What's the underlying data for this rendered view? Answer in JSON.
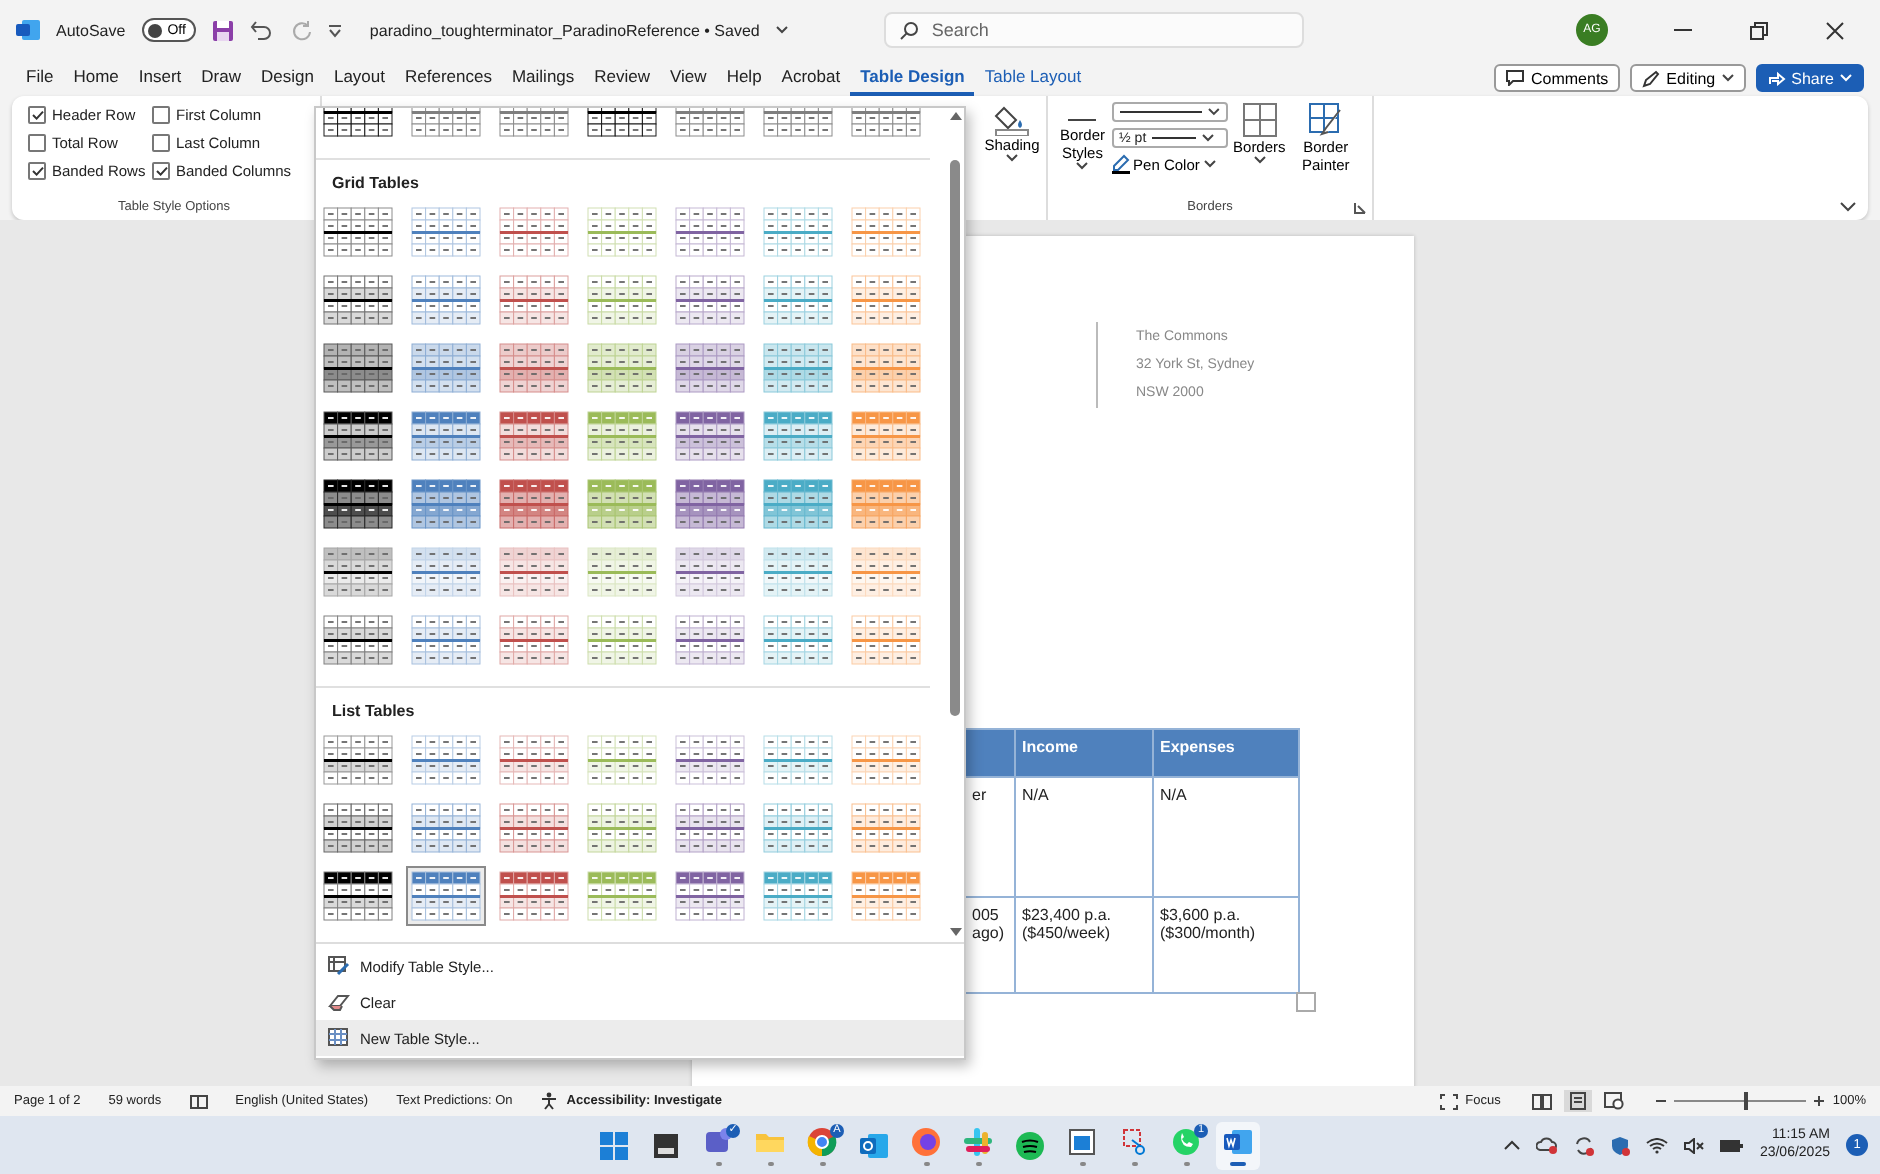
{
  "title_bar": {
    "autosave_label": "AutoSave",
    "autosave": {
      "label": "Off",
      "on": false
    },
    "document_title": "paradino_toughterminator_ParadinoReference • Saved",
    "search": {
      "placeholder": "Search"
    },
    "avatar": "AG"
  },
  "menu_tabs": [
    {
      "label": "File",
      "selected": false,
      "kind": "normal"
    },
    {
      "label": "Home",
      "selected": false,
      "kind": "normal"
    },
    {
      "label": "Insert",
      "selected": false,
      "kind": "normal"
    },
    {
      "label": "Draw",
      "selected": false,
      "kind": "normal"
    },
    {
      "label": "Design",
      "selected": false,
      "kind": "normal"
    },
    {
      "label": "Layout",
      "selected": false,
      "kind": "normal"
    },
    {
      "label": "References",
      "selected": false,
      "kind": "normal"
    },
    {
      "label": "Mailings",
      "selected": false,
      "kind": "normal"
    },
    {
      "label": "Review",
      "selected": false,
      "kind": "normal"
    },
    {
      "label": "View",
      "selected": false,
      "kind": "normal"
    },
    {
      "label": "Help",
      "selected": false,
      "kind": "normal"
    },
    {
      "label": "Acrobat",
      "selected": false,
      "kind": "normal"
    },
    {
      "label": "Table Design",
      "selected": true,
      "kind": "contextual"
    },
    {
      "label": "Table Layout",
      "selected": false,
      "kind": "contextual"
    }
  ],
  "actions": [
    {
      "label": "Comments",
      "kind": "comments"
    },
    {
      "label": "Editing",
      "kind": "editing"
    },
    {
      "label": "Share",
      "kind": "share"
    }
  ],
  "ribbon": {
    "style_options": {
      "title": "Table Style Options",
      "options": [
        {
          "label": "Header Row",
          "checked": true
        },
        {
          "label": "First Column",
          "checked": false
        },
        {
          "label": "Total Row",
          "checked": false
        },
        {
          "label": "Last Column",
          "checked": false
        },
        {
          "label": "Banded Rows",
          "checked": true
        },
        {
          "label": "Banded Columns",
          "checked": true
        }
      ]
    },
    "borders": {
      "title": "Borders",
      "shading": "Shading",
      "border_styles": "Border Styles",
      "pen_weight": "½ pt",
      "pen_color": "Pen Color",
      "borders": "Borders",
      "border_painter": "Border Painter"
    }
  },
  "style_gallery": {
    "sections": [
      {
        "rows": [
          {
            "kind": "plain",
            "styles": [
              {
                "color": "#000000",
                "selected": false
              },
              {
                "color": "#7f7f7f",
                "selected": false
              },
              {
                "color": "#7f7f7f",
                "selected": false
              },
              {
                "color": "#000000",
                "selected": false
              },
              {
                "color": "#7f7f7f",
                "selected": false
              },
              {
                "color": "#7f7f7f",
                "selected": false
              },
              {
                "color": "#7f7f7f",
                "selected": false
              }
            ]
          }
        ]
      },
      {
        "title": "Grid Tables",
        "rows": [
          {
            "kind": "grid-light",
            "styles": [
              {
                "color": "#000000",
                "selected": false
              },
              {
                "color": "#4f81bd",
                "selected": false
              },
              {
                "color": "#c0504d",
                "selected": false
              },
              {
                "color": "#9bbb59",
                "selected": false
              },
              {
                "color": "#8064a2",
                "selected": false
              },
              {
                "color": "#4bacc6",
                "selected": false
              },
              {
                "color": "#f79646",
                "selected": false
              }
            ]
          },
          {
            "kind": "grid",
            "styles": [
              {
                "color": "#000000",
                "selected": false
              },
              {
                "color": "#4f81bd",
                "selected": false
              },
              {
                "color": "#c0504d",
                "selected": false
              },
              {
                "color": "#9bbb59",
                "selected": false
              },
              {
                "color": "#8064a2",
                "selected": false
              },
              {
                "color": "#4bacc6",
                "selected": false
              },
              {
                "color": "#f79646",
                "selected": false
              }
            ]
          },
          {
            "kind": "grid-medium",
            "styles": [
              {
                "color": "#000000",
                "selected": false
              },
              {
                "color": "#4f81bd",
                "selected": false
              },
              {
                "color": "#c0504d",
                "selected": false
              },
              {
                "color": "#9bbb59",
                "selected": false
              },
              {
                "color": "#8064a2",
                "selected": false
              },
              {
                "color": "#4bacc6",
                "selected": false
              },
              {
                "color": "#f79646",
                "selected": false
              }
            ]
          },
          {
            "kind": "grid-header",
            "styles": [
              {
                "color": "#000000",
                "selected": false
              },
              {
                "color": "#4f81bd",
                "selected": false
              },
              {
                "color": "#c0504d",
                "selected": false
              },
              {
                "color": "#9bbb59",
                "selected": false
              },
              {
                "color": "#8064a2",
                "selected": false
              },
              {
                "color": "#4bacc6",
                "selected": false
              },
              {
                "color": "#f79646",
                "selected": false
              }
            ]
          },
          {
            "kind": "grid-dark",
            "styles": [
              {
                "color": "#000000",
                "selected": false
              },
              {
                "color": "#4f81bd",
                "selected": false
              },
              {
                "color": "#c0504d",
                "selected": false
              },
              {
                "color": "#9bbb59",
                "selected": false
              },
              {
                "color": "#8064a2",
                "selected": false
              },
              {
                "color": "#4bacc6",
                "selected": false
              },
              {
                "color": "#f79646",
                "selected": false
              }
            ]
          },
          {
            "kind": "grid-pale",
            "styles": [
              {
                "color": "#000000",
                "selected": false
              },
              {
                "color": "#4f81bd",
                "selected": false
              },
              {
                "color": "#c0504d",
                "selected": false
              },
              {
                "color": "#9bbb59",
                "selected": false
              },
              {
                "color": "#8064a2",
                "selected": false
              },
              {
                "color": "#4bacc6",
                "selected": false
              },
              {
                "color": "#f79646",
                "selected": false
              }
            ]
          },
          {
            "kind": "grid-colorful",
            "styles": [
              {
                "color": "#000000",
                "selected": false
              },
              {
                "color": "#4f81bd",
                "selected": false
              },
              {
                "color": "#c0504d",
                "selected": false
              },
              {
                "color": "#9bbb59",
                "selected": false
              },
              {
                "color": "#8064a2",
                "selected": false
              },
              {
                "color": "#4bacc6",
                "selected": false
              },
              {
                "color": "#f79646",
                "selected": false
              }
            ]
          }
        ]
      },
      {
        "title": "List Tables",
        "rows": [
          {
            "kind": "list-light",
            "styles": [
              {
                "color": "#000000",
                "selected": false
              },
              {
                "color": "#4f81bd",
                "selected": false
              },
              {
                "color": "#c0504d",
                "selected": false
              },
              {
                "color": "#9bbb59",
                "selected": false
              },
              {
                "color": "#8064a2",
                "selected": false
              },
              {
                "color": "#4bacc6",
                "selected": false
              },
              {
                "color": "#f79646",
                "selected": false
              }
            ]
          },
          {
            "kind": "list-medium",
            "styles": [
              {
                "color": "#000000",
                "selected": false
              },
              {
                "color": "#4f81bd",
                "selected": false
              },
              {
                "color": "#c0504d",
                "selected": false
              },
              {
                "color": "#9bbb59",
                "selected": false
              },
              {
                "color": "#8064a2",
                "selected": false
              },
              {
                "color": "#4bacc6",
                "selected": false
              },
              {
                "color": "#f79646",
                "selected": false
              }
            ]
          },
          {
            "kind": "list-header",
            "styles": [
              {
                "color": "#000000",
                "selected": false
              },
              {
                "color": "#4f81bd",
                "selected": true
              },
              {
                "color": "#c0504d",
                "selected": false
              },
              {
                "color": "#9bbb59",
                "selected": false
              },
              {
                "color": "#8064a2",
                "selected": false
              },
              {
                "color": "#4bacc6",
                "selected": false
              },
              {
                "color": "#f79646",
                "selected": false
              }
            ]
          }
        ]
      }
    ],
    "commands": [
      {
        "label": "Modify Table Style...",
        "kind": "modify",
        "hovered": false
      },
      {
        "label": "Clear",
        "kind": "clear",
        "hovered": false
      },
      {
        "label": "New Table Style...",
        "kind": "new",
        "hovered": true
      }
    ]
  },
  "document": {
    "address_lines": [
      "The Commons",
      "32 York St, Sydney",
      "NSW 2000"
    ],
    "table": {
      "columns": [
        "",
        "Income",
        "Expenses"
      ],
      "rows": [
        {
          "cells": [
            "er",
            "N/A",
            "N/A"
          ]
        },
        {
          "cells": [
            "005 ago)",
            "$23,400 p.a. ($450/week)",
            "$3,600 p.a. ($300/month)"
          ]
        }
      ]
    }
  },
  "status_bar": {
    "page": "Page 1 of 2",
    "words": "59 words",
    "language": "English (United States)",
    "predictions": "Text Predictions: On",
    "accessibility": "Accessibility: Investigate",
    "focus": "Focus",
    "views": [
      {
        "kind": "read",
        "selected": false
      },
      {
        "kind": "print",
        "selected": true
      },
      {
        "kind": "web",
        "selected": false
      }
    ],
    "zoom": {
      "level": 0.52,
      "label": "100%"
    }
  },
  "taskbar": {
    "apps": [
      {
        "kind": "start",
        "running": false,
        "active": false
      },
      {
        "kind": "terminal",
        "running": false,
        "active": false
      },
      {
        "kind": "chat",
        "running": true,
        "active": false,
        "badge": "✓"
      },
      {
        "kind": "folder",
        "running": true,
        "active": false
      },
      {
        "kind": "browser",
        "running": true,
        "active": false,
        "badge": "A"
      },
      {
        "kind": "mail",
        "running": false,
        "active": false
      },
      {
        "kind": "globe",
        "running": true,
        "active": false
      },
      {
        "kind": "hash",
        "running": true,
        "active": false
      },
      {
        "kind": "music",
        "running": false,
        "active": false
      },
      {
        "kind": "window",
        "running": true,
        "active": false
      },
      {
        "kind": "scissors",
        "running": true,
        "active": false
      },
      {
        "kind": "phone",
        "running": true,
        "active": false,
        "badge": "1"
      },
      {
        "kind": "document",
        "running": true,
        "active": true
      }
    ],
    "time": "11:15 AM",
    "date": "23/06/2025",
    "notifications": "1"
  }
}
